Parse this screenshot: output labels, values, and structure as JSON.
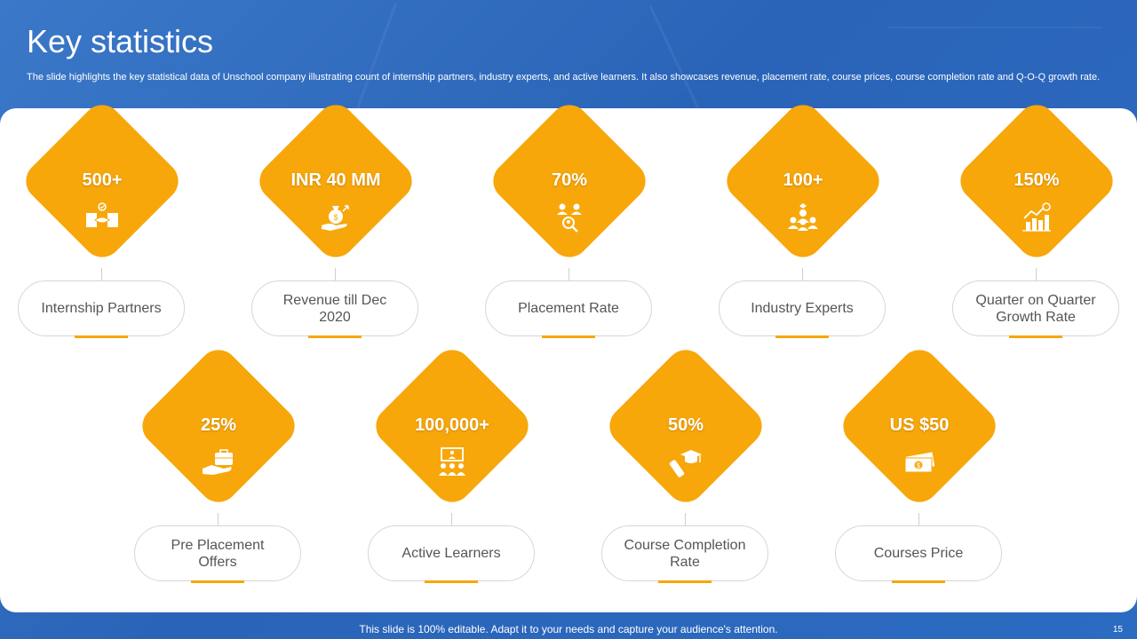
{
  "title": "Key statistics",
  "subtitle": "The slide highlights the key statistical data of Unschool company illustrating count of internship partners, industry experts, and active learners. It also showcases revenue, placement rate, course prices, course completion rate and Q-O-Q growth rate.",
  "accent_color": "#f7a70a",
  "stats": [
    {
      "value": "500+",
      "label": "Internship  Partners",
      "icon": "handshake-money-icon"
    },
    {
      "value": "INR  40 MM",
      "label": "Revenue till Dec 2020",
      "icon": "money-bag-hand-icon"
    },
    {
      "value": "70%",
      "label": "Placement Rate",
      "icon": "people-search-icon"
    },
    {
      "value": "100+",
      "label": "Industry  Experts",
      "icon": "expert-group-icon"
    },
    {
      "value": "150%",
      "label": "Quarter on Quarter Growth Rate",
      "icon": "growth-chart-icon"
    },
    {
      "value": "25%",
      "label": "Pre Placement Offers",
      "icon": "briefcase-hand-icon"
    },
    {
      "value": "100,000+",
      "label": "Active Learners",
      "icon": "classroom-icon"
    },
    {
      "value": "50%",
      "label": "Course Completion Rate",
      "icon": "graduation-cap-icon"
    },
    {
      "value": "US $50",
      "label": "Courses Price",
      "icon": "banknotes-icon"
    }
  ],
  "footer": "This slide is 100% editable. Adapt it to your needs and capture your audience's attention.",
  "page_number": "15"
}
